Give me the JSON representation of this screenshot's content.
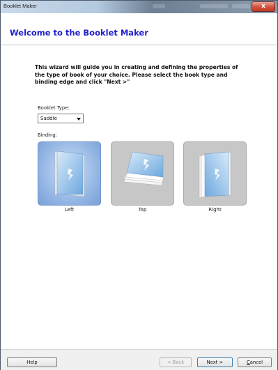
{
  "window": {
    "title": "Booklet Maker",
    "close_label": "x"
  },
  "header": {
    "title": "Welcome to the Booklet Maker"
  },
  "intro": {
    "text": "This wizard will guide you in creating and defining the properties of the type of book of your choice. Please select the book type and binding edge and click \"Next >\""
  },
  "booklet_type": {
    "label": "Booklet Type:",
    "selected": "Saddle"
  },
  "binding": {
    "label": "Binding:",
    "options": [
      {
        "label": "Left",
        "selected": true
      },
      {
        "label": "Top",
        "selected": false
      },
      {
        "label": "Right",
        "selected": false
      }
    ]
  },
  "buttons": {
    "help": "Help",
    "back": "< Back",
    "next": "Next >",
    "cancel_underlined": "C",
    "cancel_rest": "ancel"
  },
  "colors": {
    "header_title": "#1f1fcc",
    "selected_tile": "#8fb2e2",
    "tile": "#c7c7c7"
  }
}
